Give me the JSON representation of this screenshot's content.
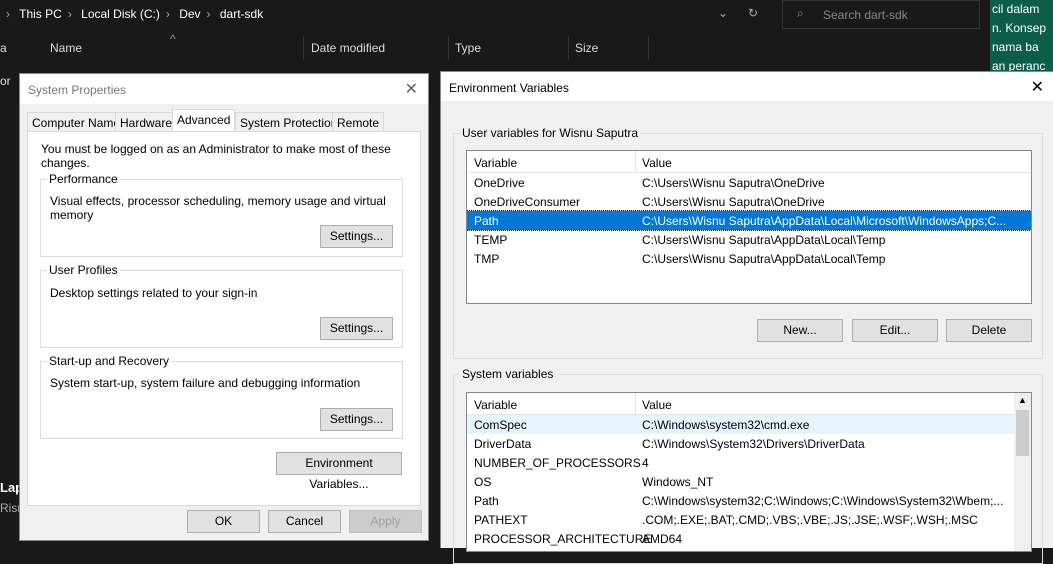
{
  "explorer": {
    "breadcrumb": [
      "This PC",
      "Local Disk (C:)",
      "Dev",
      "dart-sdk"
    ],
    "search_placeholder": "Search dart-sdk",
    "columns": [
      "Name",
      "Date modified",
      "Type",
      "Size"
    ],
    "left_fragments": [
      "a",
      "or"
    ],
    "bottom_fragments": [
      "Lap",
      "Risn"
    ]
  },
  "background_text": [
    "cil dalam",
    "n. Konsep",
    "nama ba",
    "an peranc"
  ],
  "system_properties": {
    "title": "System Properties",
    "tabs": [
      "Computer Name",
      "Hardware",
      "Advanced",
      "System Protection",
      "Remote"
    ],
    "active_tab": "Advanced",
    "admin_note": "You must be logged on as an Administrator to make most of these changes.",
    "groups": [
      {
        "label": "Performance",
        "desc": "Visual effects, processor scheduling, memory usage and virtual memory",
        "button": "Settings..."
      },
      {
        "label": "User Profiles",
        "desc": "Desktop settings related to your sign-in",
        "button": "Settings..."
      },
      {
        "label": "Start-up and Recovery",
        "desc": "System start-up, system failure and debugging information",
        "button": "Settings..."
      }
    ],
    "env_button": "Environment Variables...",
    "ok": "OK",
    "cancel": "Cancel",
    "apply": "Apply"
  },
  "env_vars": {
    "title": "Environment Variables",
    "user_label": "User variables for Wisnu Saputra",
    "col_variable": "Variable",
    "col_value": "Value",
    "user_rows": [
      [
        "OneDrive",
        "C:\\Users\\Wisnu Saputra\\OneDrive"
      ],
      [
        "OneDriveConsumer",
        "C:\\Users\\Wisnu Saputra\\OneDrive"
      ],
      [
        "Path",
        "C:\\Users\\Wisnu Saputra\\AppData\\Local\\Microsoft\\WindowsApps;C..."
      ],
      [
        "TEMP",
        "C:\\Users\\Wisnu Saputra\\AppData\\Local\\Temp"
      ],
      [
        "TMP",
        "C:\\Users\\Wisnu Saputra\\AppData\\Local\\Temp"
      ]
    ],
    "selected_user_row": 2,
    "new": "New...",
    "edit": "Edit...",
    "delete": "Delete",
    "system_label": "System variables",
    "system_rows": [
      [
        "ComSpec",
        "C:\\Windows\\system32\\cmd.exe"
      ],
      [
        "DriverData",
        "C:\\Windows\\System32\\Drivers\\DriverData"
      ],
      [
        "NUMBER_OF_PROCESSORS",
        "4"
      ],
      [
        "OS",
        "Windows_NT"
      ],
      [
        "Path",
        "C:\\Windows\\system32;C:\\Windows;C:\\Windows\\System32\\Wbem;..."
      ],
      [
        "PATHEXT",
        ".COM;.EXE;.BAT;.CMD;.VBS;.VBE;.JS;.JSE;.WSF;.WSH;.MSC"
      ],
      [
        "PROCESSOR_ARCHITECTURE",
        "AMD64"
      ]
    ]
  }
}
